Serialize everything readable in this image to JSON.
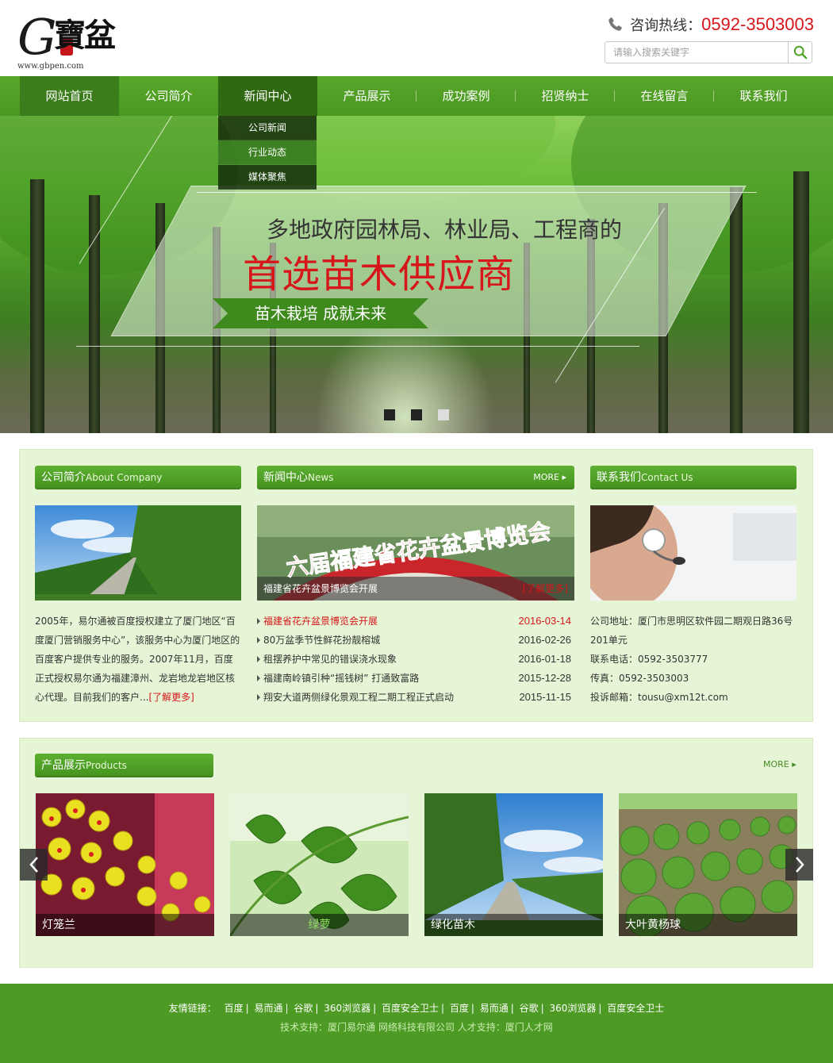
{
  "header": {
    "logo_letter": "G",
    "logo_cn": "寶盆",
    "logo_url": "www.gbpen.com",
    "hotline_label": "咨询热线：",
    "hotline_number": "0592-3503003",
    "search_placeholder": "请输入搜索关键字"
  },
  "nav": {
    "items": [
      {
        "label": "网站首页"
      },
      {
        "label": "公司简介"
      },
      {
        "label": "新闻中心"
      },
      {
        "label": "产品展示"
      },
      {
        "label": "成功案例"
      },
      {
        "label": "招贤纳士"
      },
      {
        "label": "在线留言"
      },
      {
        "label": "联系我们"
      }
    ],
    "dropdown": [
      "公司新闻",
      "行业动态",
      "媒体聚焦"
    ]
  },
  "banner": {
    "line1": "多地政府园林局、林业局、工程商的",
    "line2": "首选苗木供应商",
    "ribbon": "苗木栽培 成就未来"
  },
  "about": {
    "title": "公司简介",
    "title_en": "About Company",
    "text": "2005年，易尔通被百度授权建立了厦门地区“百度厦门营销服务中心”，该服务中心为厦门地区的百度客户提供专业的服务。2007年11月，百度正式授权易尔通为福建漳州、龙岩地龙岩地区核心代理。目前我们的客户...",
    "more": "[了解更多]"
  },
  "news": {
    "title": "新闻中心",
    "title_en": "News",
    "more": "MORE",
    "image_caption": "福建省花卉盆景博览会开展",
    "image_more": "[了解更多]",
    "image_sign": "六届福建省花卉盆景博览会",
    "items": [
      {
        "title": "福建省花卉盆景博览会开展",
        "date": "2016-03-14"
      },
      {
        "title": "80万盆季节性鲜花扮靓榕城",
        "date": "2016-02-26"
      },
      {
        "title": "租摆养护中常见的错误浇水现象",
        "date": "2016-01-18"
      },
      {
        "title": "福建南岭镇引种“摇钱树” 打通致富路",
        "date": "2015-12-28"
      },
      {
        "title": "翔安大道两侧绿化景观工程二期工程正式启动",
        "date": "2015-11-15"
      }
    ]
  },
  "contact": {
    "title": "联系我们",
    "title_en": "Contact Us",
    "lines": [
      "公司地址：厦门市思明区软件园二期观日路36号201单元",
      "联系电话：0592-3503777",
      "传真：0592-3503003",
      "投诉邮箱：tousu@xm12t.com"
    ]
  },
  "products": {
    "title": "产品展示",
    "title_en": "Products",
    "more": "MORE",
    "items": [
      {
        "name": "灯笼兰"
      },
      {
        "name": "绿萝"
      },
      {
        "name": "绿化苗木"
      },
      {
        "name": "大叶黄杨球"
      }
    ]
  },
  "footer": {
    "links_label": "友情链接：",
    "links": [
      "百度",
      "易而通",
      "谷歌",
      "360浏览器",
      "百度安全卫士",
      "百度",
      "易而通",
      "谷歌",
      "360浏览器",
      "百度安全卫士"
    ],
    "copyright": "技术支持：厦门易尔通 网络科技有限公司 人才支持：厦门人才网"
  },
  "colors": {
    "brand_green": "#4d9a25",
    "accent_red": "#d6161a",
    "section_bg": "#e6f5d6"
  }
}
